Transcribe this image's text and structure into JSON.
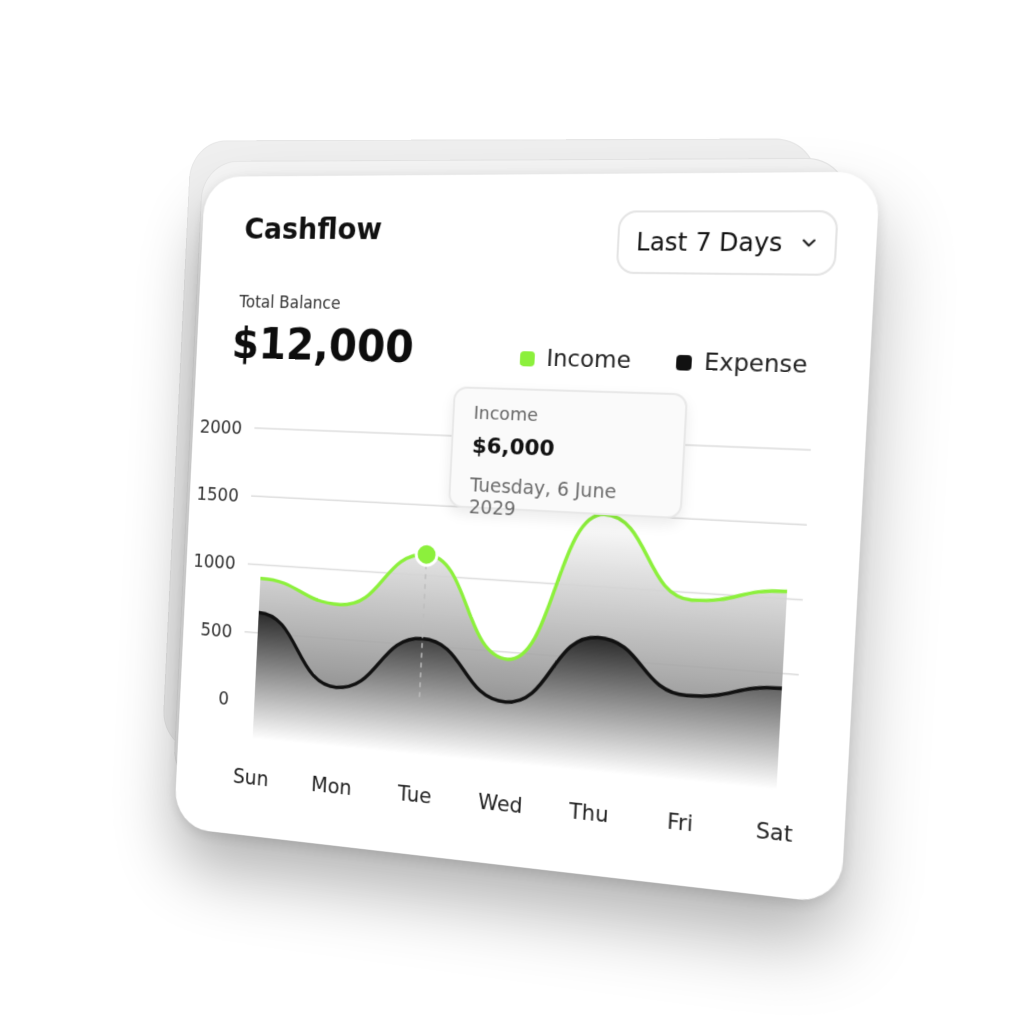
{
  "card": {
    "title": "Cashflow",
    "range_select": {
      "value": "Last 7 Days"
    },
    "balance": {
      "label": "Total Balance",
      "value": "$12,000"
    },
    "legend": [
      {
        "label": "Income",
        "color": "#8cf03c"
      },
      {
        "label": "Expense",
        "color": "#111111"
      }
    ],
    "tooltip": {
      "label": "Income",
      "value": "$6,000",
      "date": "Tuesday, 6 June 2029"
    }
  },
  "chart_data": {
    "type": "line",
    "categories": [
      "Sun",
      "Mon",
      "Tue",
      "Wed",
      "Thu",
      "Fri",
      "Sat"
    ],
    "y_ticks": [
      0,
      500,
      1000,
      1500,
      2000
    ],
    "ylim": [
      0,
      2000
    ],
    "grid": true,
    "legend_position": "top-right",
    "highlighted": {
      "series": "Income",
      "category": "Tue"
    },
    "series": [
      {
        "name": "Income",
        "color": "#8cf03c",
        "values": [
          900,
          750,
          1150,
          450,
          1500,
          950,
          1050
        ]
      },
      {
        "name": "Expense",
        "color": "#111111",
        "values": [
          650,
          150,
          550,
          150,
          650,
          300,
          400
        ]
      }
    ]
  }
}
